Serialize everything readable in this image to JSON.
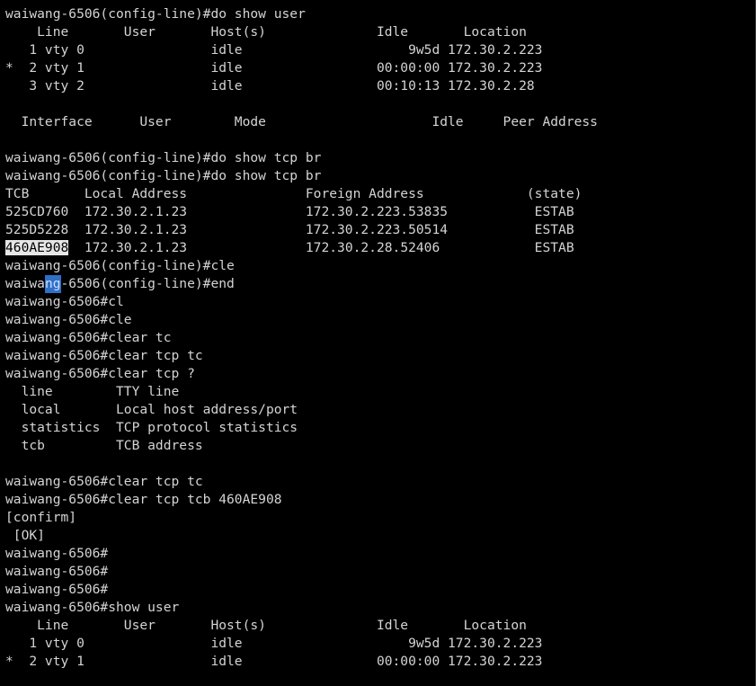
{
  "theme": {
    "background": "#000000",
    "foreground": "#d4d4d4",
    "selection_background": "#e6e6e6",
    "selection_foreground": "#000000",
    "cursor_color": "#2f6fc6"
  },
  "terminal": {
    "lines": [
      {
        "segments": [
          {
            "text": "waiwang-6506(config-line)#do show user"
          }
        ]
      },
      {
        "segments": [
          {
            "text": "    Line       User       Host(s)              Idle       Location"
          }
        ]
      },
      {
        "segments": [
          {
            "text": "   1 vty 0                idle                     9w5d 172.30.2.223"
          }
        ]
      },
      {
        "segments": [
          {
            "text": "*  2 vty 1                idle                 00:00:00 172.30.2.223"
          }
        ]
      },
      {
        "segments": [
          {
            "text": "   3 vty 2                idle                 00:10:13 172.30.2.28"
          }
        ]
      },
      {
        "segments": [
          {
            "text": ""
          }
        ]
      },
      {
        "segments": [
          {
            "text": "  Interface      User        Mode                     Idle     Peer Address"
          }
        ]
      },
      {
        "segments": [
          {
            "text": ""
          }
        ]
      },
      {
        "segments": [
          {
            "text": "waiwang-6506(config-line)#do show tcp br"
          }
        ]
      },
      {
        "segments": [
          {
            "text": "waiwang-6506(config-line)#do show tcp br"
          }
        ]
      },
      {
        "segments": [
          {
            "text": "TCB       Local Address               Foreign Address             (state)"
          }
        ]
      },
      {
        "segments": [
          {
            "text": "525CD760  172.30.2.1.23               172.30.2.223.53835           ESTAB"
          }
        ]
      },
      {
        "segments": [
          {
            "text": "525D5228  172.30.2.1.23               172.30.2.223.50514           ESTAB"
          }
        ]
      },
      {
        "segments": [
          {
            "text": "460AE908",
            "style": "highlight"
          },
          {
            "text": "  172.30.2.1.23               172.30.2.28.52406            ESTAB"
          }
        ]
      },
      {
        "segments": [
          {
            "text": "waiwang-6506(config-line)#cle"
          }
        ]
      },
      {
        "segments": [
          {
            "text": "waiwa"
          },
          {
            "text": "ng",
            "style": "cursor"
          },
          {
            "text": "-6506(config-line)#end"
          }
        ]
      },
      {
        "segments": [
          {
            "text": "waiwang-6506#cl"
          }
        ]
      },
      {
        "segments": [
          {
            "text": "waiwang-6506#cle"
          }
        ]
      },
      {
        "segments": [
          {
            "text": "waiwang-6506#clear tc"
          }
        ]
      },
      {
        "segments": [
          {
            "text": "waiwang-6506#clear tcp tc"
          }
        ]
      },
      {
        "segments": [
          {
            "text": "waiwang-6506#clear tcp ?"
          }
        ]
      },
      {
        "segments": [
          {
            "text": "  line        TTY line"
          }
        ]
      },
      {
        "segments": [
          {
            "text": "  local       Local host address/port"
          }
        ]
      },
      {
        "segments": [
          {
            "text": "  statistics  TCP protocol statistics"
          }
        ]
      },
      {
        "segments": [
          {
            "text": "  tcb         TCB address"
          }
        ]
      },
      {
        "segments": [
          {
            "text": ""
          }
        ]
      },
      {
        "segments": [
          {
            "text": "waiwang-6506#clear tcp tc"
          }
        ]
      },
      {
        "segments": [
          {
            "text": "waiwang-6506#clear tcp tcb 460AE908"
          }
        ]
      },
      {
        "segments": [
          {
            "text": "[confirm]"
          }
        ]
      },
      {
        "segments": [
          {
            "text": " [OK]"
          }
        ]
      },
      {
        "segments": [
          {
            "text": "waiwang-6506#"
          }
        ]
      },
      {
        "segments": [
          {
            "text": "waiwang-6506#"
          }
        ]
      },
      {
        "segments": [
          {
            "text": "waiwang-6506#"
          }
        ]
      },
      {
        "segments": [
          {
            "text": "waiwang-6506#show user"
          }
        ]
      },
      {
        "segments": [
          {
            "text": "    Line       User       Host(s)              Idle       Location"
          }
        ]
      },
      {
        "segments": [
          {
            "text": "   1 vty 0                idle                     9w5d 172.30.2.223"
          }
        ]
      },
      {
        "segments": [
          {
            "text": "*  2 vty 1                idle                 00:00:00 172.30.2.223"
          }
        ]
      }
    ]
  }
}
